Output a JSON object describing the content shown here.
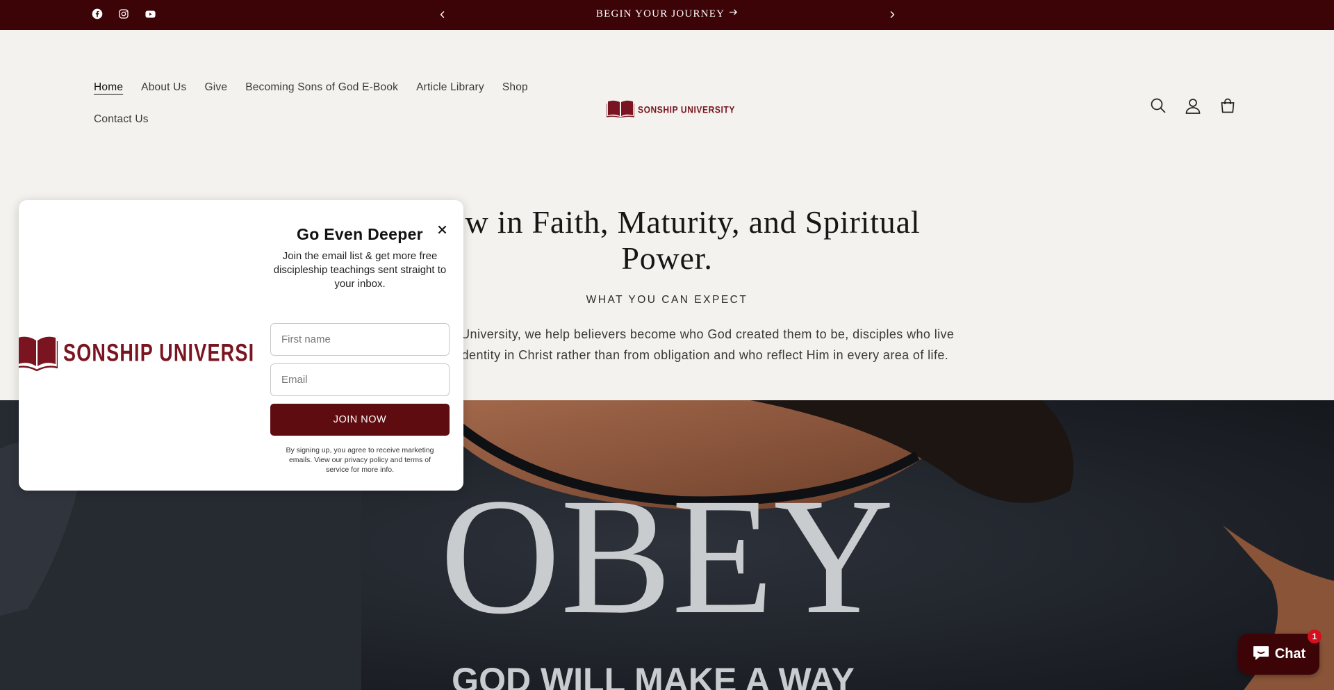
{
  "announcement": {
    "text": "BEGIN YOUR JOURNEY",
    "social_icons": [
      "facebook-icon",
      "instagram-icon",
      "youtube-icon"
    ],
    "background": "#3d0408"
  },
  "nav": {
    "items": [
      "Home",
      "About Us",
      "Give",
      "Becoming Sons of God E-Book",
      "Article Library",
      "Shop",
      "Contact Us"
    ],
    "active": "Home"
  },
  "logo": {
    "text": "SONSHIP UNIVERSITY"
  },
  "header_icons": [
    "search-icon",
    "account-icon",
    "cart-icon"
  ],
  "hero": {
    "heading": "Grow in Faith, Maturity, and Spiritual Power.",
    "subheading": "WHAT YOU CAN EXPECT",
    "description": "At Sonship University, we help believers become who God created them to be, disciples who live from their identity in Christ rather than from obligation and who reflect Him in every area of life."
  },
  "photo": {
    "shirt_text": "OBEY",
    "shirt_subtext": "GOD WILL MAKE A WAY"
  },
  "popup": {
    "logo_text": "SONSHIP UNIVERSI",
    "title": "Go Even Deeper",
    "text": "Join the email list & get more free discipleship teachings sent straight to your inbox.",
    "first_name_placeholder": "First name",
    "email_placeholder": "Email",
    "button_label": "JOIN NOW",
    "legal": "By signing up, you agree to receive marketing emails. View our privacy policy and terms of service for more info."
  },
  "chat": {
    "label": "Chat",
    "badge": "1"
  },
  "colors": {
    "brand": "#7a1420",
    "button": "#5e0c10",
    "page": "#f3f2ee"
  }
}
